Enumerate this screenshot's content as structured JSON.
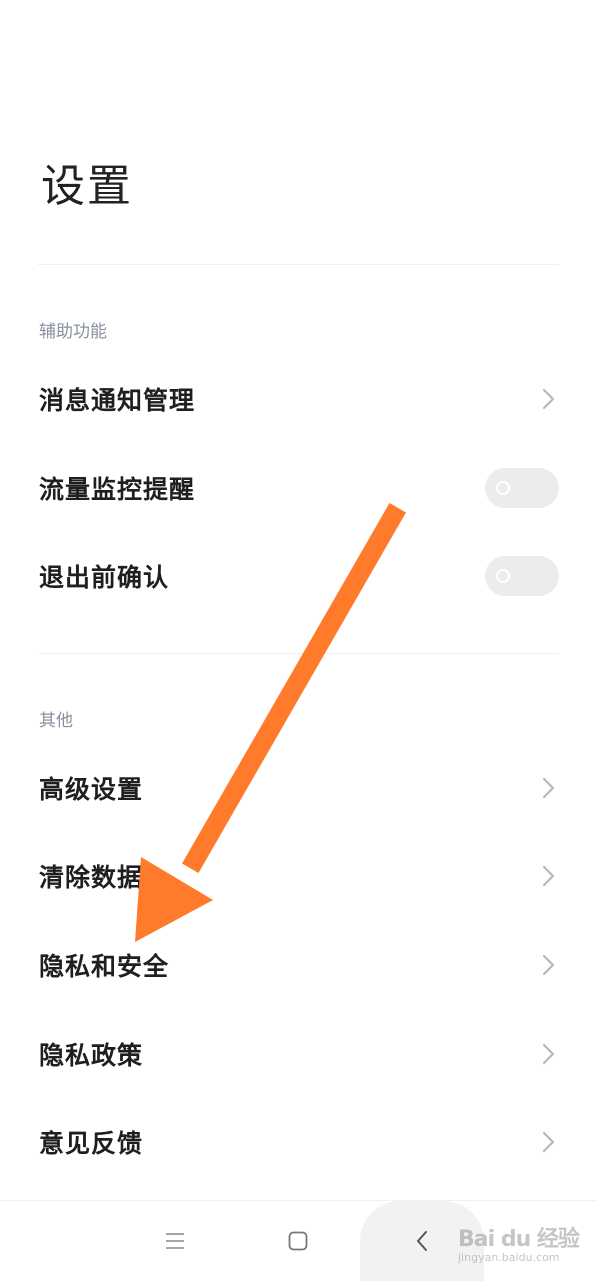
{
  "header": {
    "title": "设置"
  },
  "sections": [
    {
      "header": "辅助功能",
      "items": [
        {
          "label": "消息通知管理",
          "control": "chevron"
        },
        {
          "label": "流量监控提醒",
          "control": "toggle",
          "on": false
        },
        {
          "label": "退出前确认",
          "control": "toggle",
          "on": false
        }
      ]
    },
    {
      "header": "其他",
      "items": [
        {
          "label": "高级设置",
          "control": "chevron"
        },
        {
          "label": "清除数据",
          "control": "chevron"
        },
        {
          "label": "隐私和安全",
          "control": "chevron"
        },
        {
          "label": "隐私政策",
          "control": "chevron"
        },
        {
          "label": "意见反馈",
          "control": "chevron"
        }
      ]
    }
  ],
  "navbar": {
    "icons": [
      "menu-icon",
      "home-icon",
      "back-icon"
    ]
  },
  "annotation": {
    "arrow_color": "#ff7a2a"
  },
  "watermark": {
    "logo": "Bai du 经验",
    "url": "jingyan.baidu.com"
  },
  "colors": {
    "section_header": "#8a90a0",
    "toggle_off": "#ececec",
    "chevron": "#b8b8b8"
  }
}
